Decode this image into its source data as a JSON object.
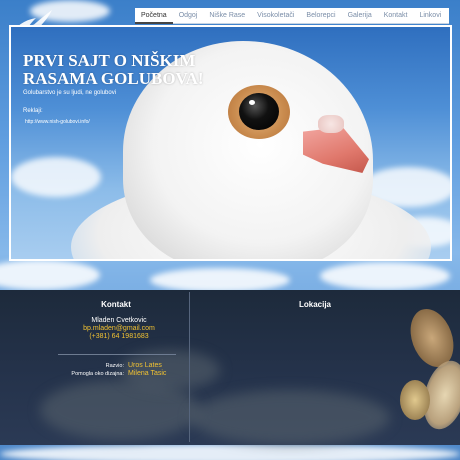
{
  "nav": {
    "items": [
      "Početna",
      "Odgoj",
      "Niške Rase",
      "Visokoletači",
      "Belorepci",
      "Galerija",
      "Kontakt",
      "Linkovi"
    ],
    "active_index": 0
  },
  "hero": {
    "title": "PRVI SAJT O NIŠKIM RASAMA GOLUBOVA!",
    "subtitle": "Golubarstvo je su ljudi, ne golubovi",
    "label": "Reklaji:",
    "url": "http://www.nish-golubovi.info/"
  },
  "footer": {
    "contact_title": "Kontakt",
    "location_title": "Lokacija",
    "name": "Mladen Cvetkovic",
    "email": "bp.mladen@gmail.com",
    "phone": "(+381) 64 1981683",
    "credits": [
      {
        "label": "Razvio:",
        "value": "Uros Lates"
      },
      {
        "label": "Pomogla oko dizajna:",
        "value": "Milena Tasic"
      }
    ]
  },
  "colors": {
    "accent_gold": "#f1c232",
    "footer_bg": "#1d2a3b",
    "sky": "#4e8fd6"
  },
  "icons": [
    "dove-logo-icon"
  ]
}
